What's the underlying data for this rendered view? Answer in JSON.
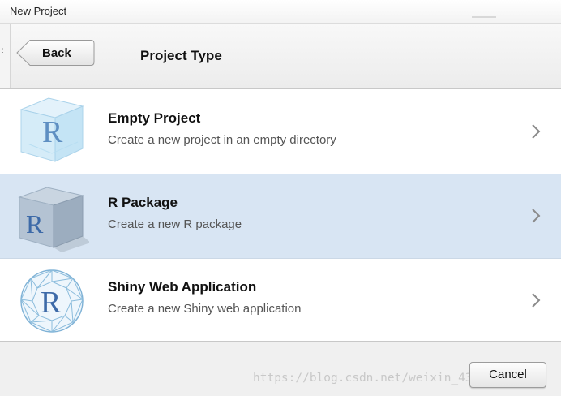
{
  "window": {
    "title": "New Project"
  },
  "header": {
    "back_label": "Back",
    "page_title": "Project Type"
  },
  "project_types": [
    {
      "name": "Empty Project",
      "description": "Create a new project in an empty directory",
      "icon": "r-glass-cube-icon",
      "selected": false
    },
    {
      "name": "R Package",
      "description": "Create a new R package",
      "icon": "r-package-box-icon",
      "selected": true
    },
    {
      "name": "Shiny Web Application",
      "description": "Create a new Shiny web application",
      "icon": "r-shiny-sphere-icon",
      "selected": false
    }
  ],
  "footer": {
    "cancel_label": "Cancel"
  },
  "watermark": "https://blog.csdn.net/weixin_43052524",
  "colors": {
    "selected_row": "#d8e5f3",
    "r_blue": "#3d6aa8"
  }
}
